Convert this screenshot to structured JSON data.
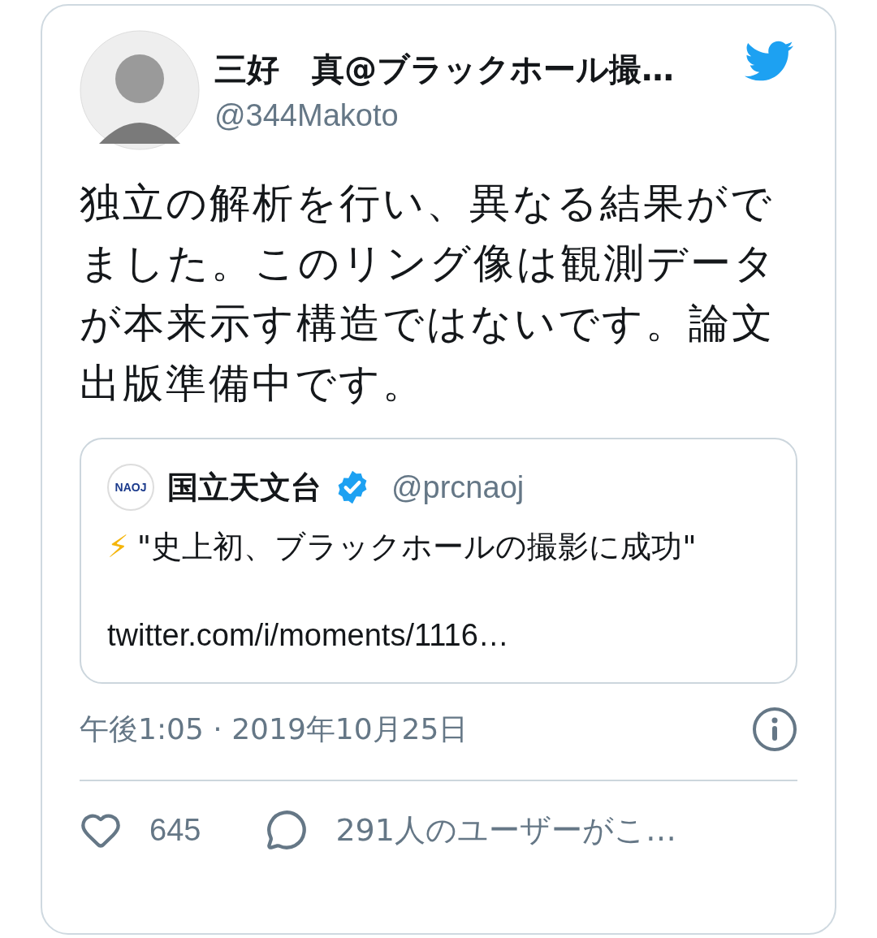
{
  "author": {
    "name": "三好　真@ブラックホール撮…",
    "handle": "@344Makoto"
  },
  "text": "独立の解析を行い、異なる結果がでました。このリング像は観測データが本来示す構造ではないです。論文出版準備中です。",
  "quoted": {
    "logo_text": "NAOJ",
    "name": "国立天文台",
    "verified": true,
    "handle": "@prcnaoj",
    "emoji": "⚡",
    "text": "\"史上初、ブラックホールの撮影に成功\"",
    "link": "twitter.com/i/moments/1116…"
  },
  "timestamp": "午後1:05 · 2019年10月25日",
  "likes": "645",
  "replies": "291人のユーザーがこ…"
}
